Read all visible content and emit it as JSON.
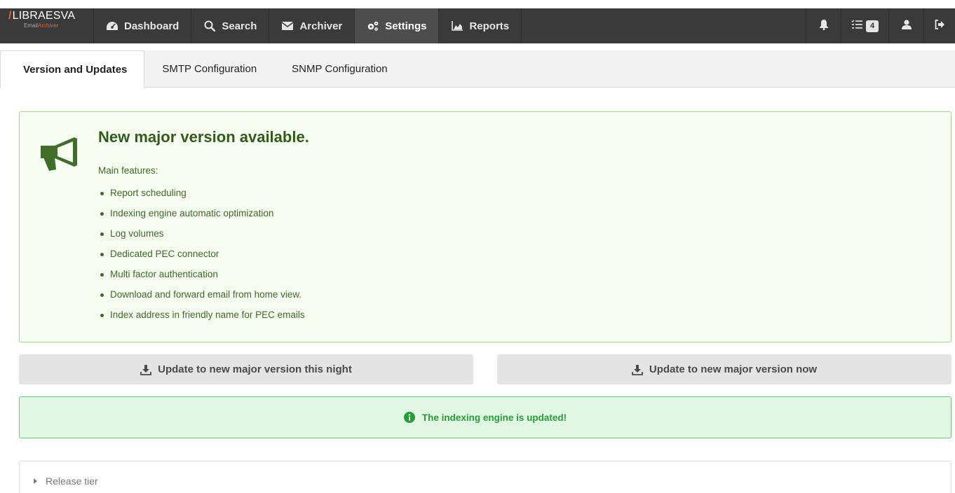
{
  "brand": {
    "name": "LIBRAESVA",
    "slash": "/",
    "sub_prefix": "Email",
    "sub_suffix": "Archiver"
  },
  "nav": {
    "items": [
      {
        "label": "Dashboard",
        "icon": "dashboard-icon"
      },
      {
        "label": "Search",
        "icon": "search-icon"
      },
      {
        "label": "Archiver",
        "icon": "envelope-icon"
      },
      {
        "label": "Settings",
        "icon": "cogs-icon",
        "active": true
      },
      {
        "label": "Reports",
        "icon": "area-chart-icon"
      }
    ],
    "tasks_count": "4"
  },
  "tabs": [
    {
      "label": "Version and Updates",
      "active": true
    },
    {
      "label": "SMTP Configuration"
    },
    {
      "label": "SNMP Configuration"
    }
  ],
  "announcement": {
    "title": "New major version available.",
    "subtitle": "Main features:",
    "features": [
      "Report scheduling",
      "Indexing engine automatic optimization",
      "Log volumes",
      "Dedicated PEC connector",
      "Multi factor authentication",
      "Download and forward email from home view.",
      "Index address in friendly name for PEC emails"
    ]
  },
  "buttons": {
    "update_night": "Update to new major version this night",
    "update_now": "Update to new major version now"
  },
  "alert": {
    "message": "The indexing engine is updated!"
  },
  "details": {
    "summary": "Release tier"
  },
  "colors": {
    "navbar": "#3a3a3a",
    "brand_accent": "#e8612c",
    "panel_bg": "#f7fcf1",
    "panel_text": "#2f5c1c",
    "alert_bg": "#e1f6e3",
    "alert_text": "#22a037"
  }
}
